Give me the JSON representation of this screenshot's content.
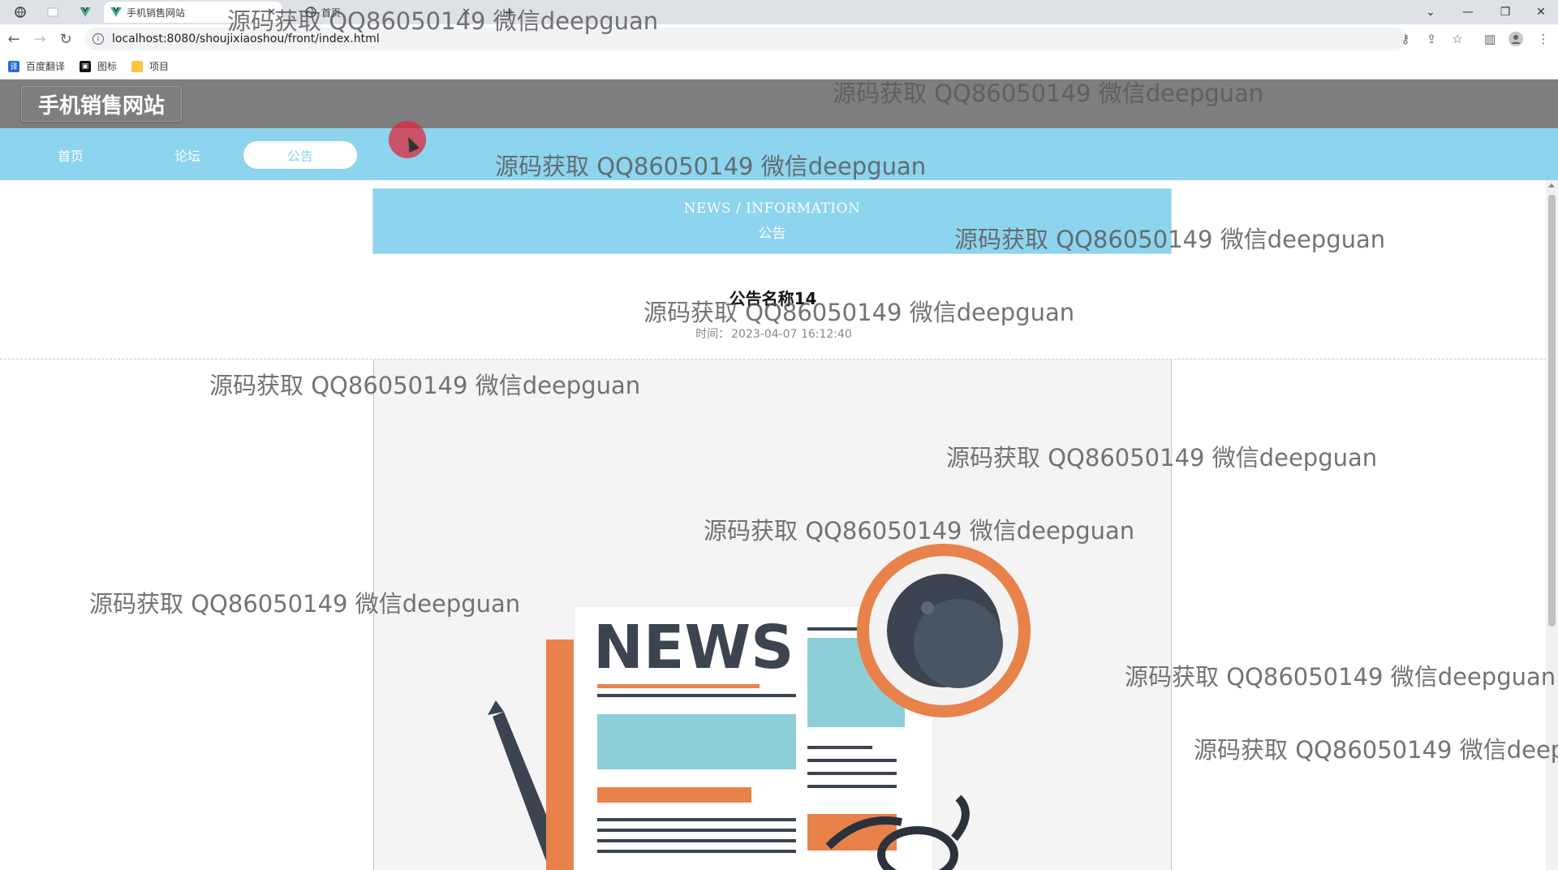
{
  "browser": {
    "tabs": [
      {
        "label": "",
        "icon": "globe-icon"
      },
      {
        "label": "",
        "icon": "blank-page-icon"
      },
      {
        "label": "",
        "icon": "vue-logo-icon"
      },
      {
        "label": "手机销售网站",
        "icon": "vue-logo-icon"
      },
      {
        "label": "首页",
        "icon": "globe-icon"
      }
    ],
    "new_tab_label": "+",
    "url": "localhost:8080/shoujixiaoshou/front/index.html",
    "bookmarks": [
      {
        "label": "百度翻译",
        "icon": "translate-icon"
      },
      {
        "label": "图标",
        "icon": "image-icon"
      },
      {
        "label": "项目",
        "icon": "folder-icon"
      }
    ]
  },
  "site": {
    "title": "手机销售网站"
  },
  "nav": {
    "items": [
      {
        "label": "首页",
        "active": false
      },
      {
        "label": "论坛",
        "active": false
      },
      {
        "label": "公告",
        "active": true
      },
      {
        "label": "",
        "active": false
      },
      {
        "label": "",
        "active": false
      },
      {
        "label": "",
        "active": false
      },
      {
        "label": "",
        "active": false
      }
    ]
  },
  "banner": {
    "en": "NEWS / INFORMATION",
    "zh": "公告"
  },
  "article": {
    "title": "公告名称14",
    "time_label": "时间：",
    "time_value": "2023-04-07 16:12:40",
    "image_text": "NEWS"
  },
  "watermark": "源码获取 QQ86050149 微信deepguan",
  "colors": {
    "nav_bg": "#8dd4ef",
    "header_bg": "#7d7e80",
    "news_orange": "#e8824a",
    "news_blue": "#8dcfd9",
    "news_dark": "#3b4450"
  }
}
